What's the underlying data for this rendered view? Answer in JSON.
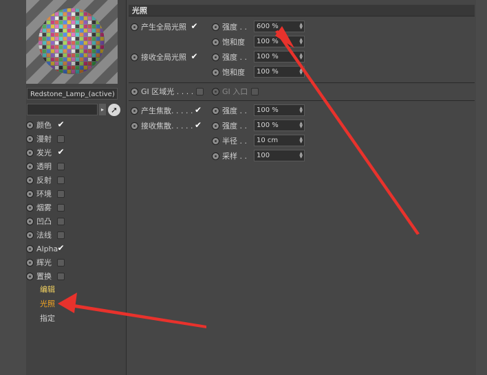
{
  "material_name": "Redstone_Lamp_(active)",
  "channels": [
    {
      "label": "颜色",
      "checked": true
    },
    {
      "label": "漫射",
      "checked": false
    },
    {
      "label": "发光",
      "checked": true
    },
    {
      "label": "透明",
      "checked": false
    },
    {
      "label": "反射",
      "checked": false
    },
    {
      "label": "环境",
      "checked": false
    },
    {
      "label": "烟雾",
      "checked": false
    },
    {
      "label": "凹凸",
      "checked": false
    },
    {
      "label": "法线",
      "checked": false
    },
    {
      "label": "Alpha",
      "checked": true
    },
    {
      "label": "辉光",
      "checked": false
    },
    {
      "label": "置换",
      "checked": false
    }
  ],
  "links": {
    "edit": "编辑",
    "illumination": "光照",
    "assign": "指定"
  },
  "panel_title": "光照",
  "gi_generate": {
    "label": "产生全局光照",
    "checked": true
  },
  "gi_receive": {
    "label": "接收全局光照",
    "checked": true
  },
  "gi_area": {
    "label": "GI 区域光 . . . ."
  },
  "gi_portal": {
    "label": "GI 入口"
  },
  "caustics_generate": {
    "label": "产生焦散. . . . .",
    "checked": true
  },
  "caustics_receive": {
    "label": "接收焦散. . . . .",
    "checked": true
  },
  "params": {
    "strength_label": "强度 . .",
    "saturation_label": "饱和度",
    "radius_label": "半径 . .",
    "samples_label": "采样 . .",
    "gi_gen_strength": "600 %",
    "gi_gen_saturation": "100 %",
    "gi_recv_strength": "100 %",
    "gi_recv_saturation": "100 %",
    "caus_gen_strength": "100 %",
    "caus_recv_strength": "100 %",
    "caus_radius": "10 cm",
    "caus_samples": "100"
  },
  "colors": {
    "accent_link": "#f0d060",
    "active_link": "#f5a623",
    "annotation_arrow": "#e8322c"
  }
}
